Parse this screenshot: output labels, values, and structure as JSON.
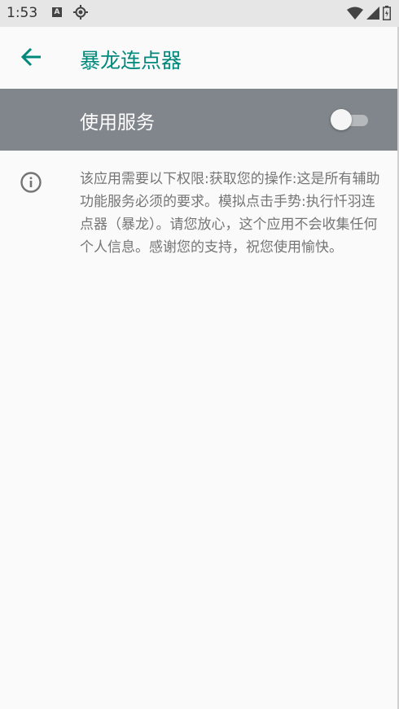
{
  "status_bar": {
    "time": "1:53",
    "notification_icon_letter": "A",
    "icons": [
      "a-notification-icon",
      "location-icon",
      "wifi-icon",
      "signal-icon",
      "battery-icon"
    ]
  },
  "app_bar": {
    "title": "暴龙连点器",
    "back_icon": "arrow-back-icon",
    "accent_color": "#00897b"
  },
  "service": {
    "label": "使用服务",
    "enabled": false,
    "row_color": "#80868b"
  },
  "description": {
    "icon": "info-icon",
    "text": "该应用需要以下权限:获取您的操作:这是所有辅助功能服务必须的要求。模拟点击手势:执行忏羽连点器（暴龙）。请您放心，这个应用不会收集任何个人信息。感谢您的支持，祝您使用愉快。"
  }
}
